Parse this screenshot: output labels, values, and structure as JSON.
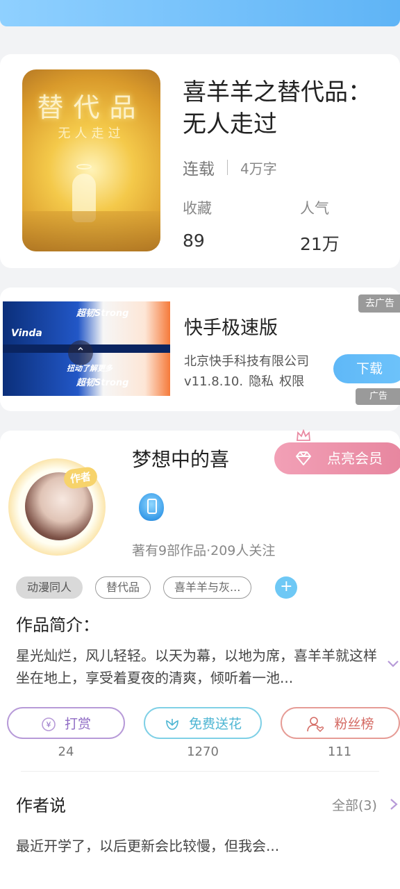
{
  "book": {
    "title": "喜羊羊之替代品：无人走过",
    "cover_title": "替代品",
    "cover_subtitle": "无人走过",
    "status": "连载",
    "word_count": "4万字",
    "favorites_label": "收藏",
    "favorites_value": "89",
    "popularity_label": "人气",
    "popularity_value": "21万"
  },
  "ad": {
    "app_name": "快手极速版",
    "company": "北京快手科技有限公司",
    "version": "v11.8.10.",
    "privacy": "隐私",
    "permissions": "权限",
    "download_label": "下载",
    "close_label": "去广告",
    "ad_label": "广告",
    "image_brand": "Vinda",
    "image_text_top": "超韧Strong",
    "image_text_mid": "扭动了解更多",
    "image_text_bottom": "超韧Strong"
  },
  "author": {
    "name": "梦想中的喜",
    "badge": "作者",
    "stats": "著有9部作品·209人关注",
    "vip_label": "点亮会员"
  },
  "tags": [
    "动漫同人",
    "替代品",
    "喜羊羊与灰..."
  ],
  "intro": {
    "heading": "作品简介：",
    "body": "星光灿烂，风儿轻轻。以天为幕，以地为席，喜羊羊就这样坐在地上，享受着夏夜的清爽，倾听着一池..."
  },
  "actions": {
    "reward_label": "打赏",
    "reward_count": "24",
    "flower_label": "免费送花",
    "flower_count": "1270",
    "fans_label": "粉丝榜",
    "fans_count": "111"
  },
  "author_says": {
    "heading": "作者说",
    "all_label": "全部(3)",
    "body": "最近开学了，以后更新会比较慢，但我会..."
  },
  "colors": {
    "accent_blue": "#5fb4f6",
    "vip_pink": "#e7869f",
    "reward_purple": "#8f6bc4",
    "flower_cyan": "#4eb6d3",
    "fans_red": "#d46a63"
  }
}
